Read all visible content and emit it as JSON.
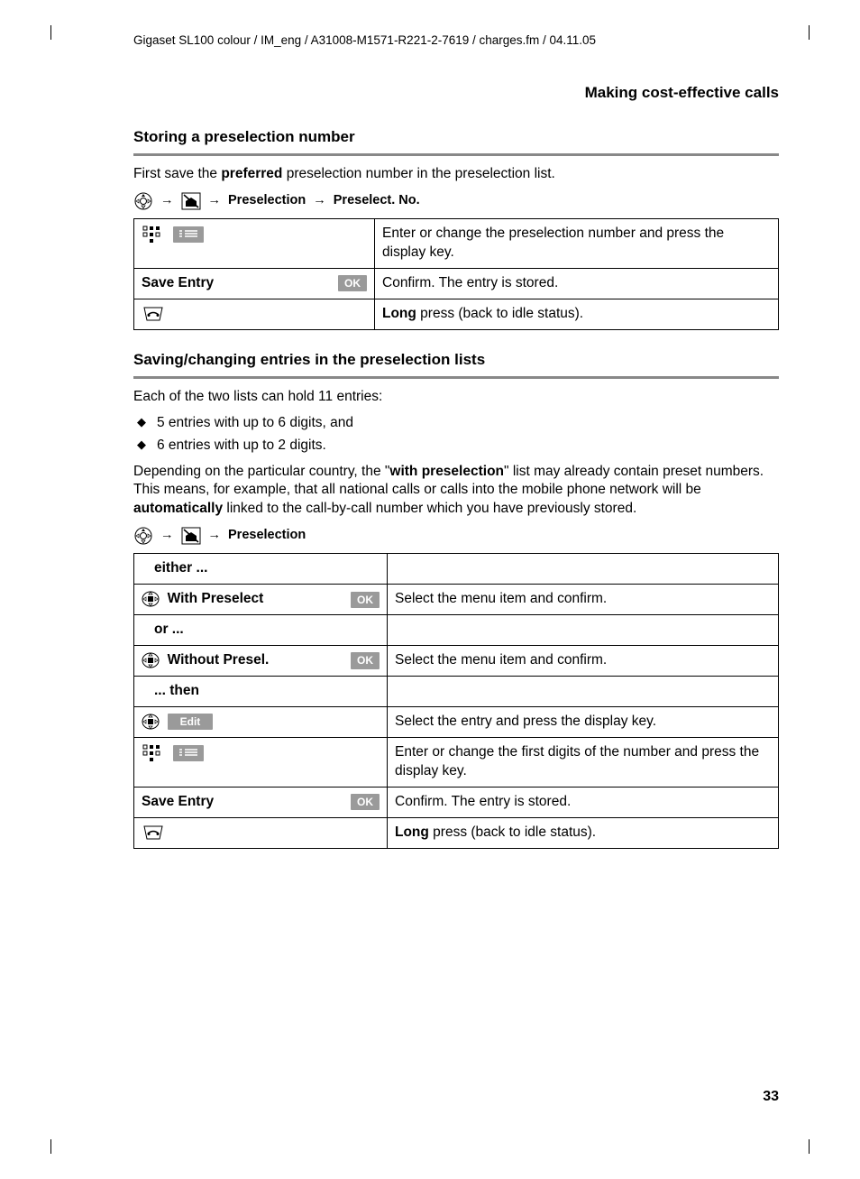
{
  "header": "Gigaset SL100 colour / IM_eng / A31008-M1571-R221-2-7619 / charges.fm / 04.11.05",
  "section_title": "Making cost-effective calls",
  "h1": "Storing a preselection number",
  "p1_pre": "First save the ",
  "p1_bold": "preferred",
  "p1_post": " preselection number in the preselection list.",
  "nav1": {
    "a": "Preselection",
    "b": "Preselect. No."
  },
  "table1": {
    "r1_right": "Enter or change the preselection number and press the display key.",
    "r2_left": "Save Entry",
    "r2_key": "OK",
    "r2_right": "Confirm. The entry is stored.",
    "r3_bold": "Long",
    "r3_rest": " press (back to idle status)."
  },
  "h2": "Saving/changing entries in the preselection lists",
  "p2": "Each of the two lists can hold 11 entries:",
  "bullets": [
    "5 entries with up to 6 digits, and",
    "6 entries with up to 2 digits."
  ],
  "p3_a": "Depending on the particular country, the \"",
  "p3_bold1": "with preselection",
  "p3_b": "\" list may already contain preset numbers. This means, for example, that all national calls or calls into the mobile phone network will be ",
  "p3_bold2": "automatically",
  "p3_c": " linked to the call-by-call number which you have previously stored.",
  "nav2": {
    "a": "Preselection"
  },
  "table2": {
    "either": "either ...",
    "r1_label": "With Preselect",
    "r1_key": "OK",
    "r1_right": "Select the menu item and confirm.",
    "or": "or ...",
    "r2_label": "Without Presel.",
    "r2_key": "OK",
    "r2_right": "Select the menu item and confirm.",
    "then": "... then",
    "r3_key": "Edit",
    "r3_right": "Select the entry and press the display key.",
    "r4_right": "Enter or change the first digits of the number and press the display key.",
    "r5_left": "Save Entry",
    "r5_key": "OK",
    "r5_right": "Confirm. The entry is stored.",
    "r6_bold": "Long",
    "r6_rest": " press (back to idle status)."
  },
  "page_number": "33"
}
